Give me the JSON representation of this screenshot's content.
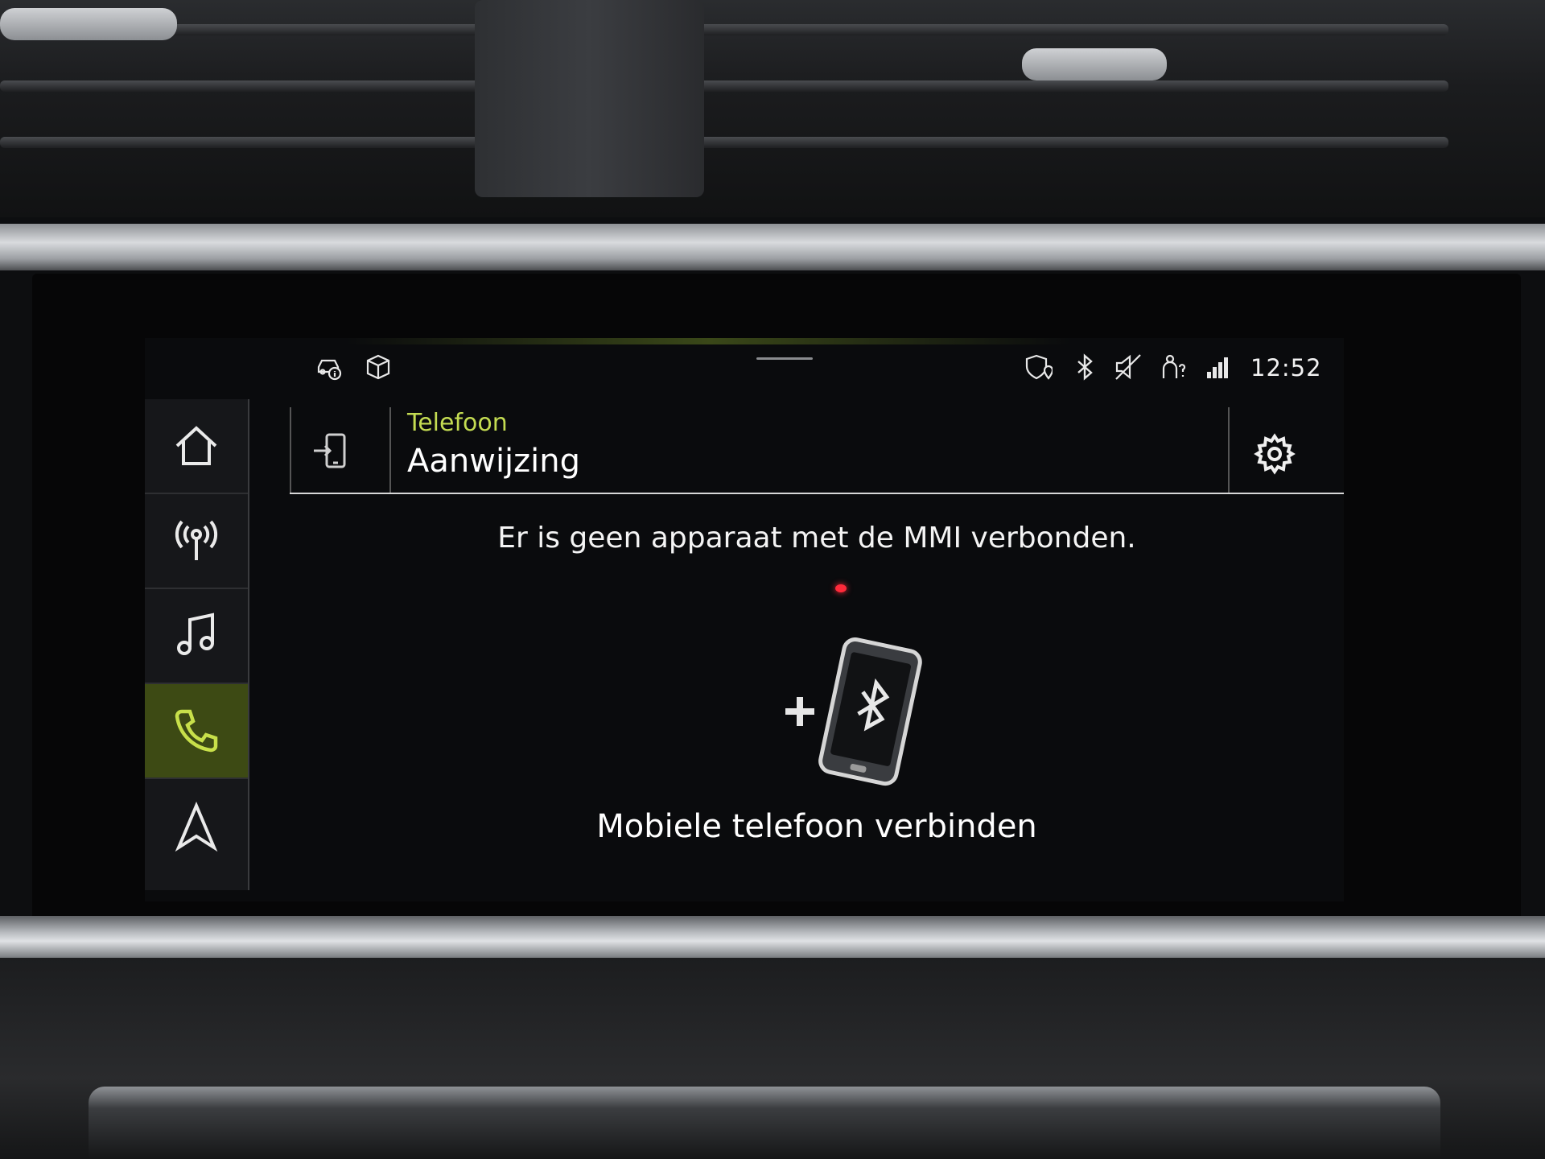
{
  "status_bar": {
    "time": "12:52",
    "icons": [
      "car-info-icon",
      "package-icon",
      "shield-location-icon",
      "bluetooth-icon",
      "mute-icon",
      "person-help-icon",
      "lte-signal-icon"
    ]
  },
  "sidebar": {
    "items": [
      {
        "name": "home",
        "icon": "home-icon"
      },
      {
        "name": "radio",
        "icon": "radio-antenna-icon"
      },
      {
        "name": "music",
        "icon": "music-note-icon"
      },
      {
        "name": "phone",
        "icon": "phone-icon",
        "active": true
      },
      {
        "name": "navigation",
        "icon": "navigation-arrow-icon"
      }
    ]
  },
  "header": {
    "section": "Telefoon",
    "title": "Aanwijzing",
    "left_icon": "phone-transfer-icon",
    "right_icon": "gear-icon"
  },
  "main": {
    "message": "Er is geen apparaat met de MMI verbonden.",
    "connect_icon": "add-bluetooth-phone-icon",
    "connect_label": "Mobiele telefoon verbinden"
  },
  "colors": {
    "accent": "#c4dc52",
    "active_bg": "#3d4a14",
    "background": "#0a0b0d"
  }
}
